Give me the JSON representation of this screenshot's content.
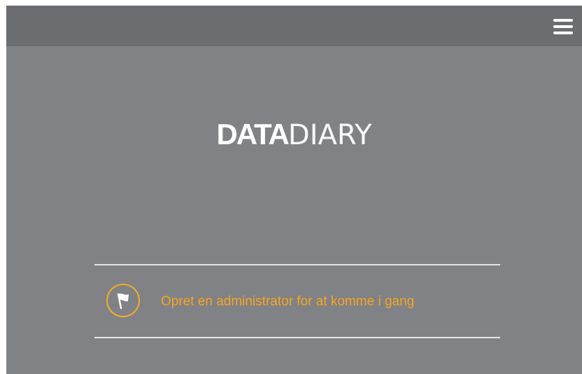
{
  "header": {
    "menu_icon": "hamburger-menu-icon"
  },
  "logo": {
    "bold_part": "DATA",
    "light_part": "DIARY"
  },
  "notice": {
    "icon": "flag-icon",
    "text": "Opret en administrator for at komme i gang"
  },
  "colors": {
    "background": "#818285",
    "header": "#6c6d70",
    "accent": "#f5a623",
    "divider": "#e6e6e6",
    "logo": "#ffffff"
  }
}
